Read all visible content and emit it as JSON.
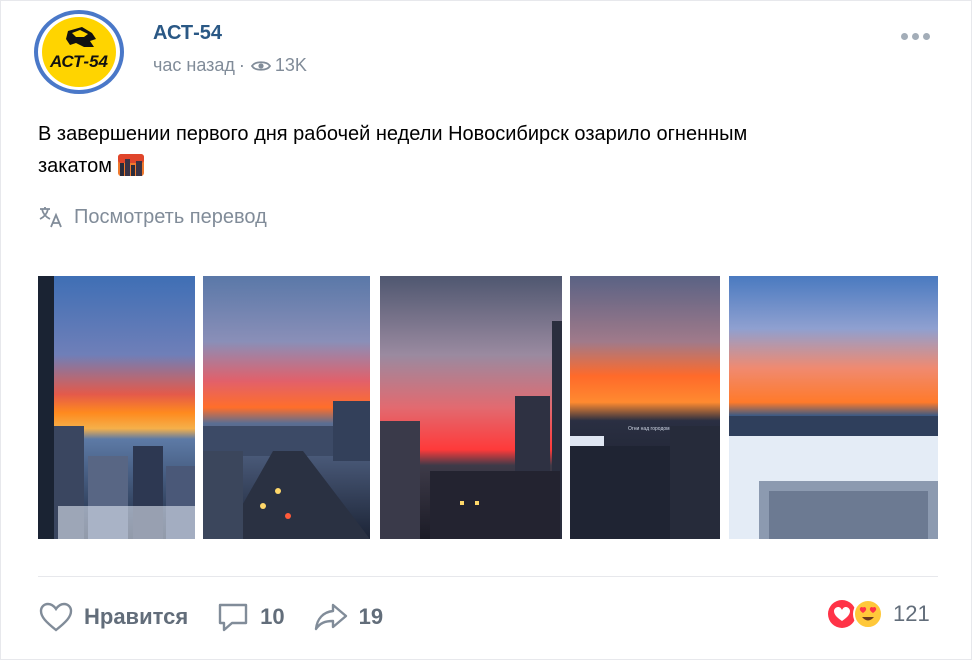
{
  "post": {
    "author": "АСТ-54",
    "avatar_logo_text": "АСТ-54",
    "time": "час назад",
    "views": "13K",
    "text_line1": "В завершении первого дня рабочей недели Новосибирск озарило огненным",
    "text_line2": "закатом",
    "translate_label": "Посмотреть перевод",
    "photo_caption": "Огни над городом"
  },
  "actions": {
    "like_label": "Нравится",
    "comments_count": "10",
    "shares_count": "19",
    "reactions_count": "121"
  },
  "colors": {
    "author_link": "#2a5885",
    "meta_gray": "#818c99",
    "action_gray": "#626d7a",
    "avatar_border": "#4a78c8",
    "avatar_fill": "#ffd400"
  }
}
